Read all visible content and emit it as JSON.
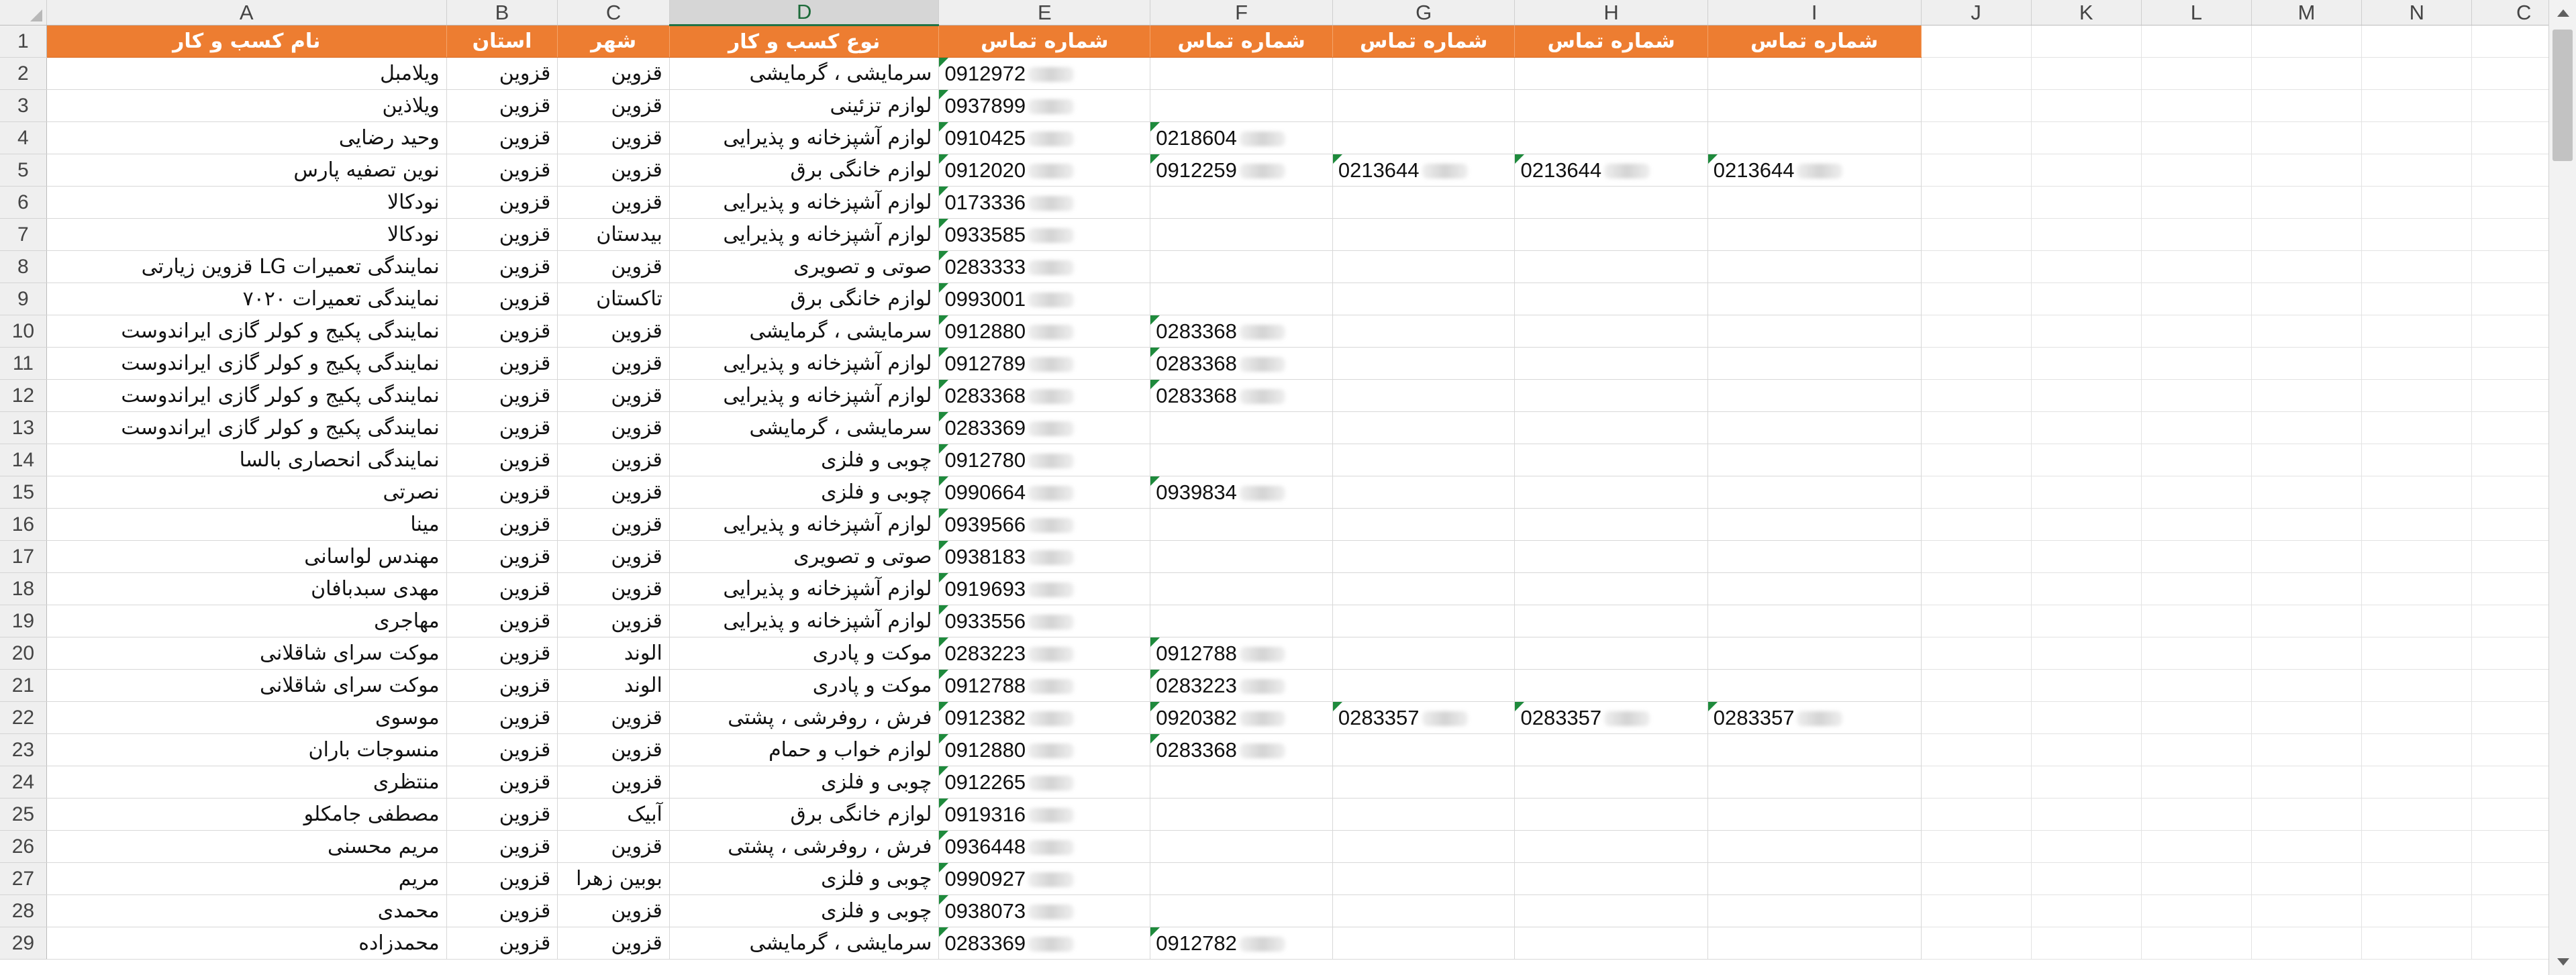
{
  "columns": [
    "A",
    "B",
    "C",
    "D",
    "E",
    "F",
    "G",
    "H",
    "I",
    "J",
    "K",
    "L",
    "M",
    "N",
    "C"
  ],
  "header": [
    "نام کسب و کار",
    "استان",
    "شهر",
    "نوع کسب و کار",
    "شماره تماس",
    "شماره تماس",
    "شماره تماس",
    "شماره تماس",
    "شماره تماس"
  ],
  "rows": [
    {
      "num": "2",
      "name": "ویلامبل",
      "province": "قزوین",
      "city": "قزوین",
      "type": "سرمایشی ، گرمایشی",
      "phones": [
        "0912972"
      ]
    },
    {
      "num": "3",
      "name": "ویلاذین",
      "province": "قزوین",
      "city": "قزوین",
      "type": "لوازم تزئینی",
      "phones": [
        "0937899"
      ]
    },
    {
      "num": "4",
      "name": "وحید رضایی",
      "province": "قزوین",
      "city": "قزوین",
      "type": "لوازم آشپزخانه و پذیرایی",
      "phones": [
        "0910425",
        "0218604"
      ]
    },
    {
      "num": "5",
      "name": "نوین تصفیه پارس",
      "province": "قزوین",
      "city": "قزوین",
      "type": "لوازم خانگی برق",
      "phones": [
        "0912020",
        "0912259",
        "0213644",
        "0213644",
        "0213644"
      ]
    },
    {
      "num": "6",
      "name": "نودکالا",
      "province": "قزوین",
      "city": "قزوین",
      "type": "لوازم آشپزخانه و پذیرایی",
      "phones": [
        "0173336"
      ]
    },
    {
      "num": "7",
      "name": "نودکالا",
      "province": "قزوین",
      "city": "بیدستان",
      "type": "لوازم آشپزخانه و پذیرایی",
      "phones": [
        "0933585"
      ]
    },
    {
      "num": "8",
      "name": "نمایندگی تعمیرات LG  قزوین زیارتی",
      "province": "قزوین",
      "city": "قزوین",
      "type": "صوتی و تصویری",
      "phones": [
        "0283333"
      ]
    },
    {
      "num": "9",
      "name": "نمایندگی تعمیرات ۷۰۲۰",
      "province": "قزوین",
      "city": "تاکستان",
      "type": "لوازم خانگی برق",
      "phones": [
        "0993001"
      ]
    },
    {
      "num": "10",
      "name": "نمایندگی پکیج و کولر گازی ایراندوست",
      "province": "قزوین",
      "city": "قزوین",
      "type": "سرمایشی ، گرمایشی",
      "phones": [
        "0912880",
        "0283368"
      ]
    },
    {
      "num": "11",
      "name": "نمایندگی پکیج و کولر گازی ایراندوست",
      "province": "قزوین",
      "city": "قزوین",
      "type": "لوازم آشپزخانه و پذیرایی",
      "phones": [
        "0912789",
        "0283368"
      ]
    },
    {
      "num": "12",
      "name": "نمایندگی پکیج و کولر گازی ایراندوست",
      "province": "قزوین",
      "city": "قزوین",
      "type": "لوازم آشپزخانه و پذیرایی",
      "phones": [
        "0283368",
        "0283368"
      ]
    },
    {
      "num": "13",
      "name": "نمایندگی پکیج و کولر گازی ایراندوست",
      "province": "قزوین",
      "city": "قزوین",
      "type": "سرمایشی ، گرمایشی",
      "phones": [
        "0283369"
      ]
    },
    {
      "num": "14",
      "name": "نمایندگی انحصاری بالسا",
      "province": "قزوین",
      "city": "قزوین",
      "type": "چوبی و فلزی",
      "phones": [
        "0912780"
      ]
    },
    {
      "num": "15",
      "name": "نصرتی",
      "province": "قزوین",
      "city": "قزوین",
      "type": "چوبی و فلزی",
      "phones": [
        "0990664",
        "0939834"
      ]
    },
    {
      "num": "16",
      "name": "مینا",
      "province": "قزوین",
      "city": "قزوین",
      "type": "لوازم آشپزخانه و پذیرایی",
      "phones": [
        "0939566"
      ]
    },
    {
      "num": "17",
      "name": "مهندس لواسانی",
      "province": "قزوین",
      "city": "قزوین",
      "type": "صوتی و تصویری",
      "phones": [
        "0938183"
      ]
    },
    {
      "num": "18",
      "name": "مهدی سبدبافان",
      "province": "قزوین",
      "city": "قزوین",
      "type": "لوازم آشپزخانه و پذیرایی",
      "phones": [
        "0919693"
      ]
    },
    {
      "num": "19",
      "name": "مهاجری",
      "province": "قزوین",
      "city": "قزوین",
      "type": "لوازم آشپزخانه و پذیرایی",
      "phones": [
        "0933556"
      ]
    },
    {
      "num": "20",
      "name": "موکت سرای شاقلانی",
      "province": "قزوین",
      "city": "الوند",
      "type": "موکت و پادری",
      "phones": [
        "0283223",
        "0912788"
      ]
    },
    {
      "num": "21",
      "name": "موکت سرای شاقلانی",
      "province": "قزوین",
      "city": "الوند",
      "type": "موکت و پادری",
      "phones": [
        "0912788",
        "0283223"
      ]
    },
    {
      "num": "22",
      "name": "موسوی",
      "province": "قزوین",
      "city": "قزوین",
      "type": "فرش ، روفرشی ، پشتی",
      "phones": [
        "0912382",
        "0920382",
        "0283357",
        "0283357",
        "0283357"
      ]
    },
    {
      "num": "23",
      "name": "منسوجات باران",
      "province": "قزوین",
      "city": "قزوین",
      "type": "لوازم خواب و حمام",
      "phones": [
        "0912880",
        "0283368"
      ]
    },
    {
      "num": "24",
      "name": "منتظری",
      "province": "قزوین",
      "city": "قزوین",
      "type": "چوبی و فلزی",
      "phones": [
        "0912265"
      ]
    },
    {
      "num": "25",
      "name": "مصطفی جامکلو",
      "province": "قزوین",
      "city": "آبیک",
      "type": "لوازم خانگی برق",
      "phones": [
        "0919316"
      ]
    },
    {
      "num": "26",
      "name": "مریم محسنی",
      "province": "قزوین",
      "city": "قزوین",
      "type": "فرش ، روفرشی ، پشتی",
      "phones": [
        "0936448"
      ]
    },
    {
      "num": "27",
      "name": "مریم",
      "province": "قزوین",
      "city": "بوبین زهرا",
      "type": "چوبی و فلزی",
      "phones": [
        "0990927"
      ]
    },
    {
      "num": "28",
      "name": "محمدی",
      "province": "قزوین",
      "city": "قزوین",
      "type": "چوبی و فلزی",
      "phones": [
        "0938073"
      ]
    },
    {
      "num": "29",
      "name": "محمدزاده",
      "province": "قزوین",
      "city": "قزوین",
      "type": "سرمایشی ، گرمایشی",
      "phones": [
        "0283369",
        "0912782"
      ]
    }
  ],
  "colors": {
    "header_fill": "#ed7d31",
    "header_text": "#ffffff",
    "selected_column": "#217346",
    "error_flag": "#1e8a3c"
  }
}
